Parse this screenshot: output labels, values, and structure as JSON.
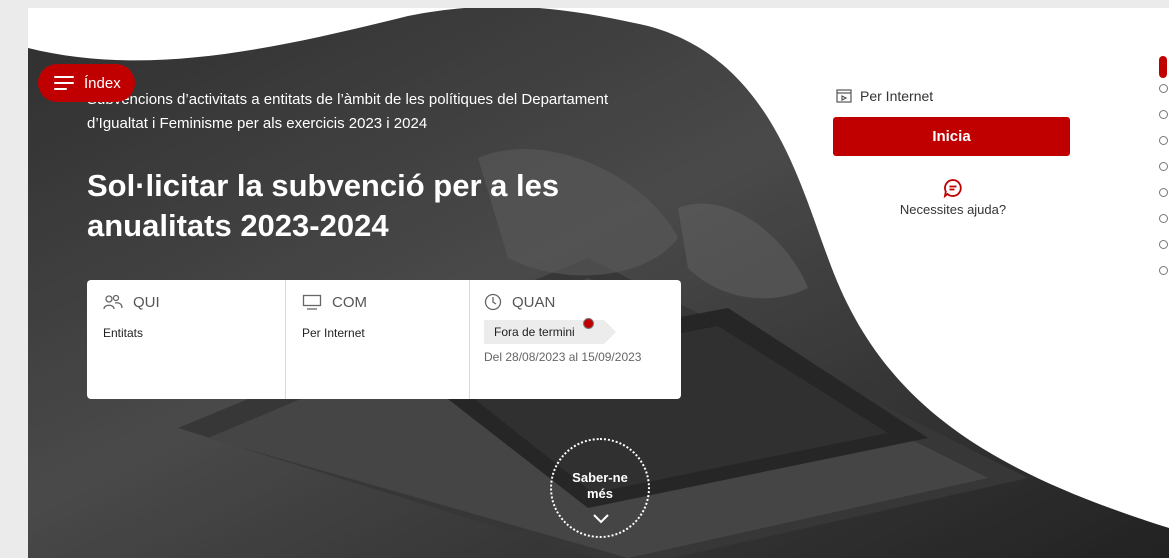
{
  "header": {
    "index_label": "Índex"
  },
  "hero": {
    "subtitle": "Subvencions d’activitats a entitats de l’àmbit de les polítiques del Departament d’Igualtat i Feminisme per als exercicis 2023 i 2024",
    "title": "Sol·licitar la subvenció per a les anualitats 2023-2024"
  },
  "info": {
    "who": {
      "label": "QUI",
      "value": "Entitats",
      "icon": "people-icon"
    },
    "how": {
      "label": "COM",
      "value": "Per Internet",
      "icon": "monitor-icon"
    },
    "when": {
      "label": "QUAN",
      "status": "Fora de termini",
      "dates": "Del 28/08/2023 al 15/09/2023",
      "icon": "clock-icon"
    }
  },
  "more": {
    "label_line1": "Saber-ne",
    "label_line2": "més"
  },
  "panel": {
    "channel": "Per Internet",
    "start_button": "Inicia",
    "help": "Necessites ajuda?"
  },
  "colors": {
    "accent": "#c00000"
  }
}
